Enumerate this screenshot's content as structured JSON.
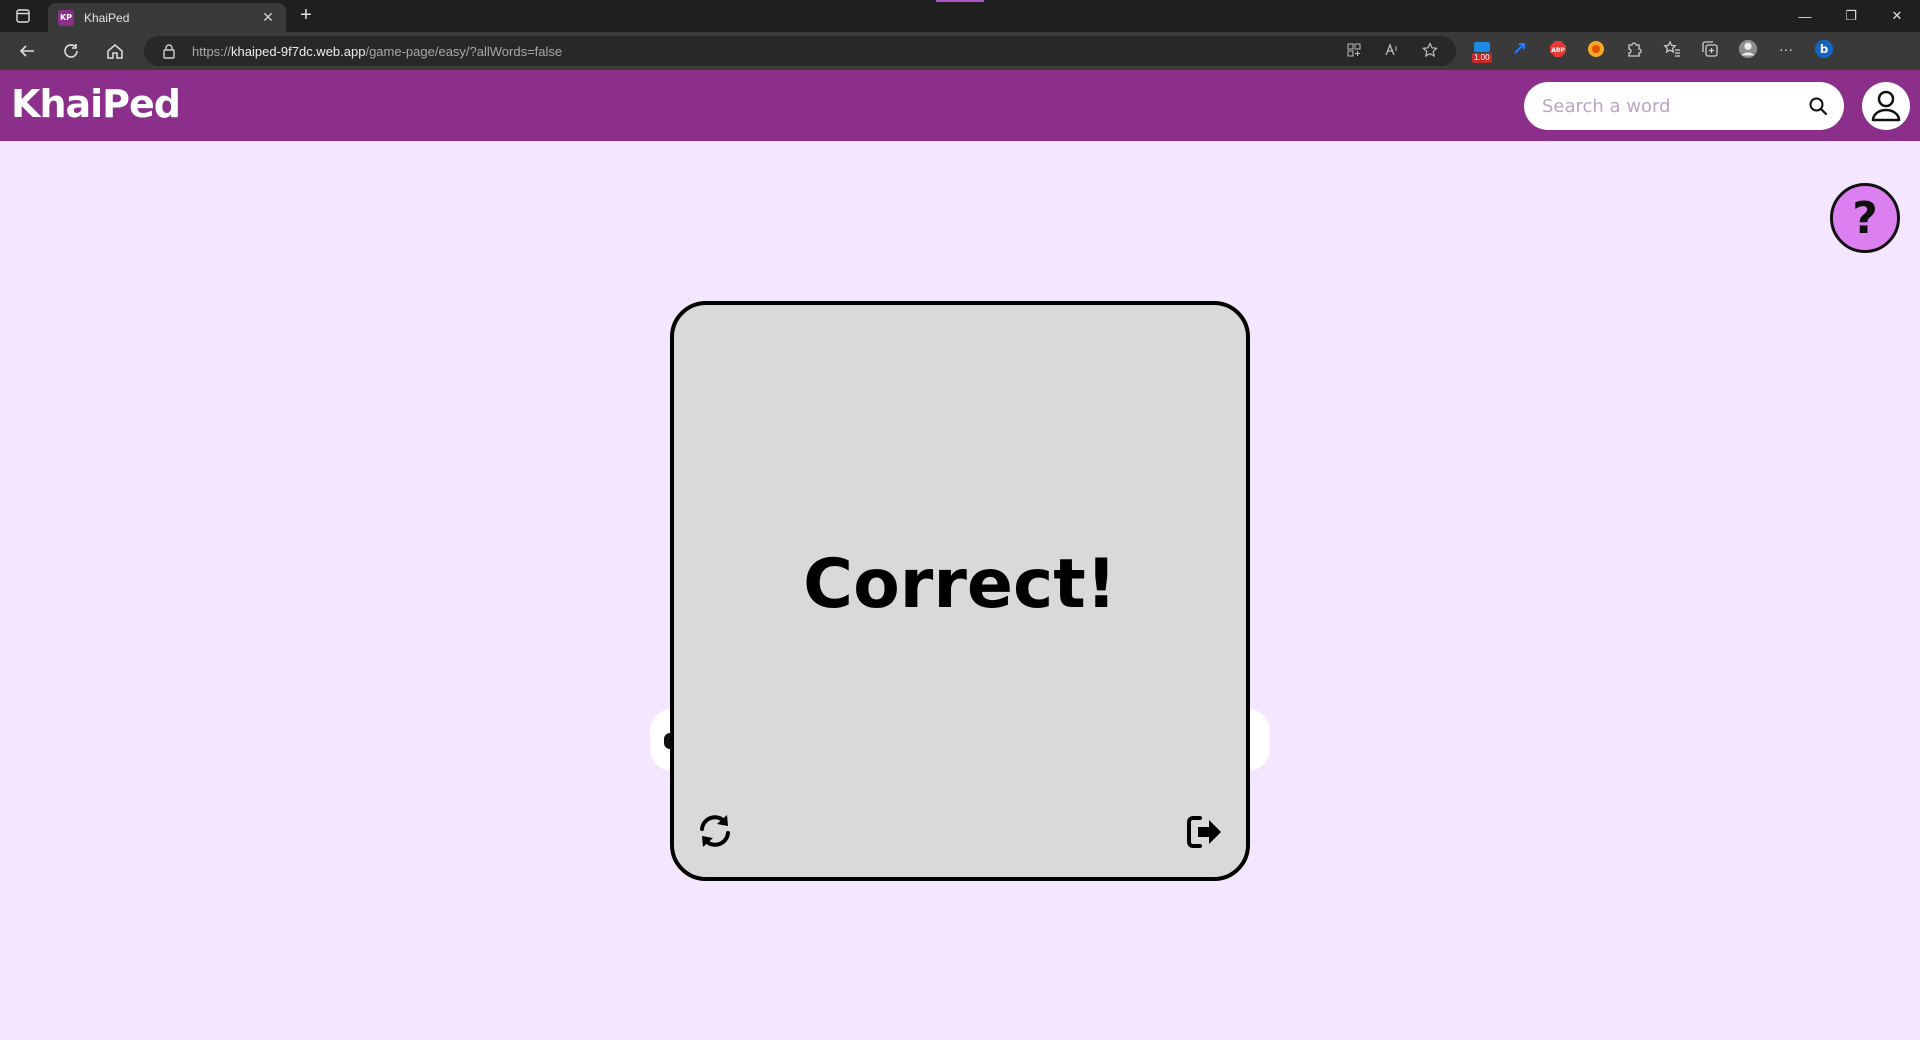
{
  "browser": {
    "tab": {
      "favicon_text": "KP",
      "title": "KhaiPed",
      "close": "✕"
    },
    "new_tab": "+",
    "window_controls": {
      "minimize": "—",
      "restore": "❐",
      "close": "✕"
    },
    "url": {
      "scheme": "https://",
      "host": "khaiped-9f7dc.web.app",
      "path": "/game-page/easy/?allWords=false"
    },
    "extensions": {
      "badge_text": "1.00"
    },
    "more": "···"
  },
  "header": {
    "logo": "KhaiPed",
    "search": {
      "placeholder": "Search a word",
      "value": ""
    }
  },
  "page": {
    "help_label": "?",
    "card": {
      "message": "Correct!"
    }
  },
  "colors": {
    "header_bg": "#8b2f8b",
    "page_bg": "#f5e6ff",
    "card_bg": "#d9d9d9",
    "help_bg": "#dc7ff0"
  }
}
